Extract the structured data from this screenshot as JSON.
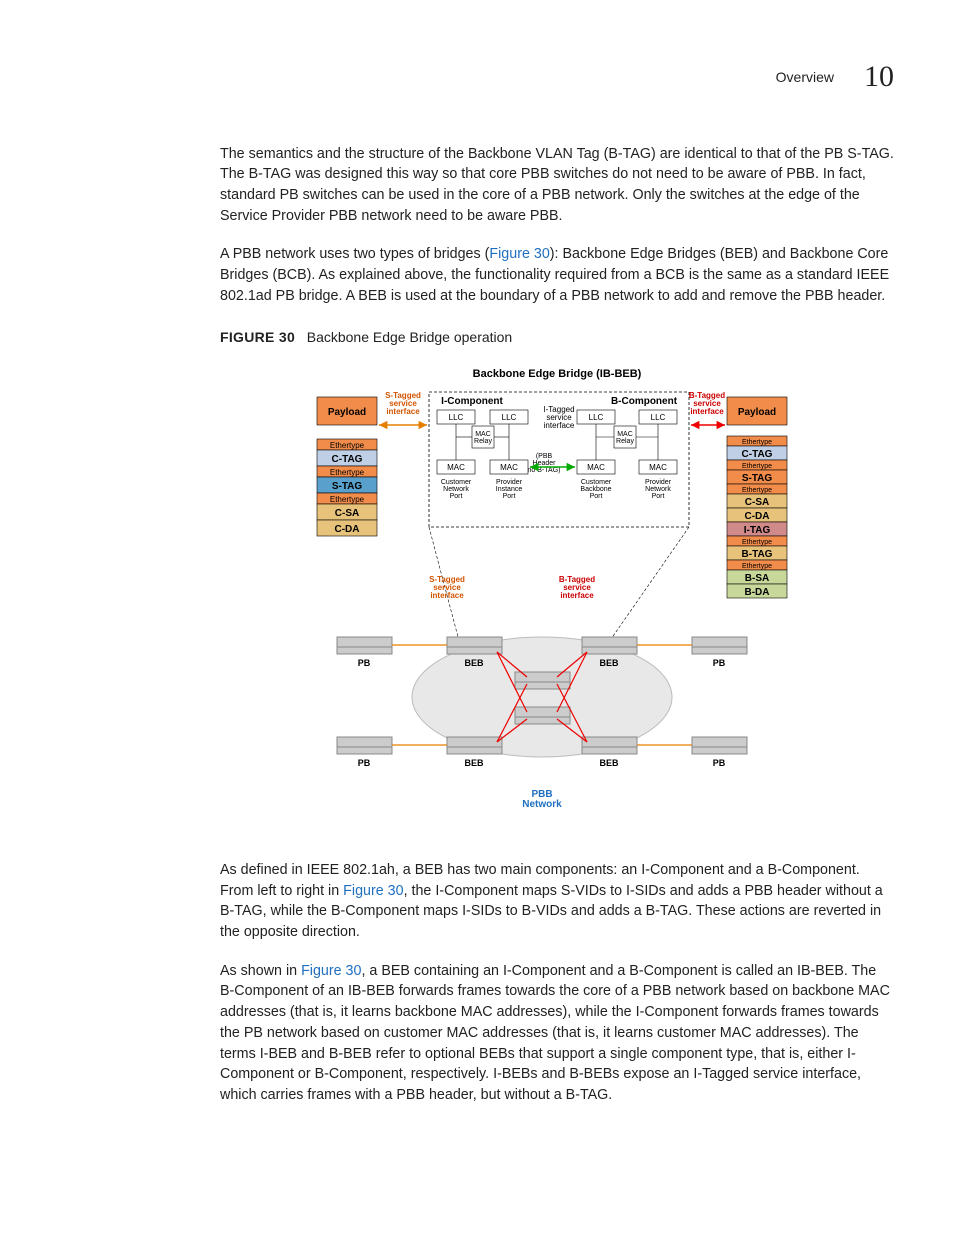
{
  "header": {
    "section": "Overview",
    "chapter": "10"
  },
  "paragraphs": {
    "p1": "The semantics and the structure of the Backbone VLAN Tag (B-TAG) are identical to that of the PB S-TAG. The B-TAG was designed this way so that core PBB switches do not need to be aware of PBB. In fact, standard PB switches can be used in the core of a PBB network. Only the switches at the edge of the Service Provider PBB network need to be aware PBB.",
    "p2a": "A PBB network uses two types of bridges (",
    "p2b": "): Backbone Edge Bridges (BEB) and Backbone Core Bridges (BCB). As explained above, the functionality required from a BCB is the same as a standard IEEE 802.1ad PB bridge. A BEB is used at the boundary of a PBB network to add and remove the PBB header.",
    "figlabel": "FIGURE 30",
    "figcaption": "Backbone Edge Bridge operation",
    "figlink": "Figure 30",
    "p3a": "As defined in IEEE 802.1ah, a BEB has two main components: an I-Component and a B-Component. From left to right in ",
    "p3b": ", the I-Component maps S-VIDs to I-SIDs and adds a PBB header without a B-TAG, while the B-Component maps I-SIDs to B-VIDs and adds a B-TAG. These actions are reverted in the opposite direction.",
    "p4a": "As shown in ",
    "p4b": ", a BEB containing an I-Component and a B-Component is called an IB-BEB. The B-Component of an IB-BEB forwards frames towards the core of a PBB network based on backbone MAC addresses (that is, it learns backbone MAC addresses), while the I-Component forwards frames towards the PB network based on customer MAC addresses (that is, it learns customer MAC addresses). The terms I-BEB and B-BEB refer to optional BEBs that support a single component type, that is, either I-Component or B-Component, respectively. I-BEBs and B-BEBs expose an I-Tagged service interface, which carries frames with a PBB header, but without a B-TAG."
  },
  "diagram": {
    "title": "Backbone Edge Bridge (IB-BEB)",
    "left_interface": "S-Tagged\nservice\ninterface",
    "right_interface": "B-Tagged\nservice\ninterface",
    "icomp": "I-Component",
    "bcomp": "B-Component",
    "itag_if": "I-Tagged\nservice\ninterface",
    "llc": "LLC",
    "mac": "MAC",
    "mac_relay": "MAC\nRelay",
    "pbb_note": "(PBB\nHeader\nno B-TAG)",
    "cust_net_port": "Customer\nNetwork\nPort",
    "prov_inst_port": "Provider\nInstance\nPort",
    "cust_bb_port": "Customer\nBackbone\nPort",
    "prov_net_port": "Provider\nNetwork\nPort",
    "payload": "Payload",
    "ethertype": "Ethertype",
    "ctag": "C-TAG",
    "stag": "S-TAG",
    "csa": "C-SA",
    "cda": "C-DA",
    "itag": "I-TAG",
    "btag": "B-TAG",
    "bsa": "B-SA",
    "bda": "B-DA",
    "pb": "PB",
    "beb": "BEB",
    "pbb_net": "PBB\nNetwork"
  }
}
